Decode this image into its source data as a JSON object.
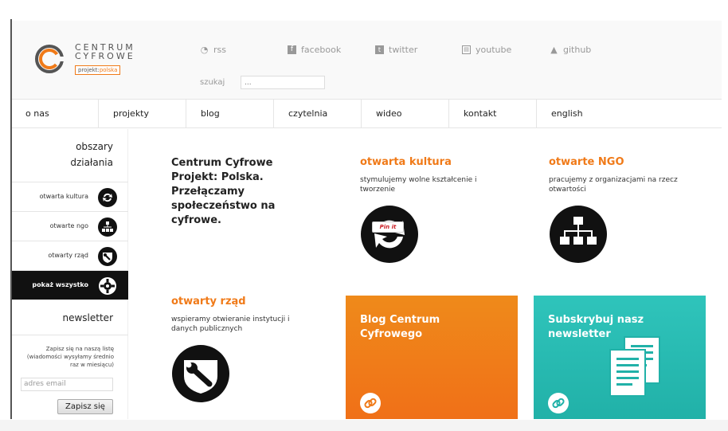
{
  "logo": {
    "title_line1": "CENTRUM",
    "title_line2": "CYFROWE",
    "badge_prefix": "projekt:",
    "badge_accent": "polska"
  },
  "social": [
    {
      "label": "rss",
      "icon": "rss-icon"
    },
    {
      "label": "facebook",
      "icon": "facebook-icon"
    },
    {
      "label": "twitter",
      "icon": "twitter-icon"
    },
    {
      "label": "youtube",
      "icon": "youtube-icon"
    },
    {
      "label": "github",
      "icon": "github-icon"
    }
  ],
  "search": {
    "label": "szukaj",
    "placeholder": "..."
  },
  "nav": [
    "o nas",
    "projekty",
    "blog",
    "czytelnia",
    "wideo",
    "kontakt",
    "english"
  ],
  "sidebar": {
    "heading_line1": "obszary",
    "heading_line2": "działania",
    "items": [
      {
        "label": "otwarta kultura",
        "icon": "culture-refresh-icon"
      },
      {
        "label": "otwarte ngo",
        "icon": "ngo-org-icon"
      },
      {
        "label": "otwarty rząd",
        "icon": "government-tool-icon"
      },
      {
        "label": "pokaż wszystko",
        "icon": "show-all-gear-icon"
      }
    ],
    "newsletter_heading": "newsletter",
    "newsletter_text": "Zapisz się na naszą listę (wiadomości wysyłamy średnio raz w miesiącu)",
    "newsletter_placeholder": "adres email",
    "newsletter_button": "Zapisz się"
  },
  "content": {
    "intro": "Centrum Cyfrowe Projekt: Polska. Przełączamy społeczeństwo na cyfrowe.",
    "blocks": [
      {
        "title": "otwarta kultura",
        "text": "stymulujemy wolne kształcenie i tworzenie",
        "pin": "Pin it"
      },
      {
        "title": "otwarte NGO",
        "text": "pracujemy z organizacjami na rzecz otwartości"
      },
      {
        "title": "otwarty rząd",
        "text": "wspieramy otwieranie instytucji i danych publicznych"
      }
    ],
    "tiles": [
      {
        "title": "Blog Centrum Cyfrowego"
      },
      {
        "title": "Subskrybuj nasz newsletter"
      }
    ]
  },
  "colors": {
    "accent": "#f07a18",
    "teal": "#2bbdb4",
    "dark": "#111111"
  }
}
